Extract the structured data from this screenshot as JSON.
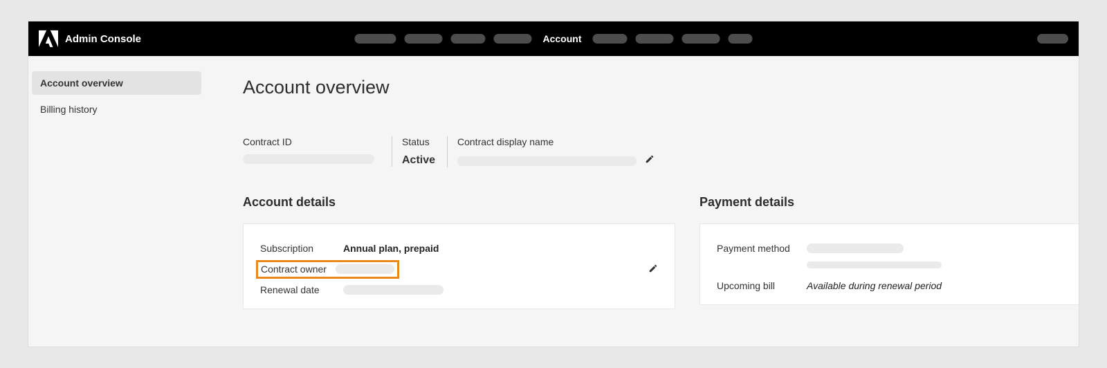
{
  "header": {
    "app_name": "Admin Console",
    "active_nav": "Account"
  },
  "sidebar": {
    "items": [
      {
        "label": "Account overview",
        "active": true
      },
      {
        "label": "Billing history",
        "active": false
      }
    ]
  },
  "page": {
    "title": "Account overview",
    "contract": {
      "id_label": "Contract ID",
      "status_label": "Status",
      "status_value": "Active",
      "display_name_label": "Contract display name"
    },
    "account_details": {
      "title": "Account details",
      "subscription_label": "Subscription",
      "subscription_value": "Annual plan, prepaid",
      "contract_owner_label": "Contract owner",
      "renewal_date_label": "Renewal date"
    },
    "payment_details": {
      "title": "Payment details",
      "payment_method_label": "Payment method",
      "upcoming_bill_label": "Upcoming bill",
      "upcoming_bill_value": "Available during renewal period"
    }
  }
}
